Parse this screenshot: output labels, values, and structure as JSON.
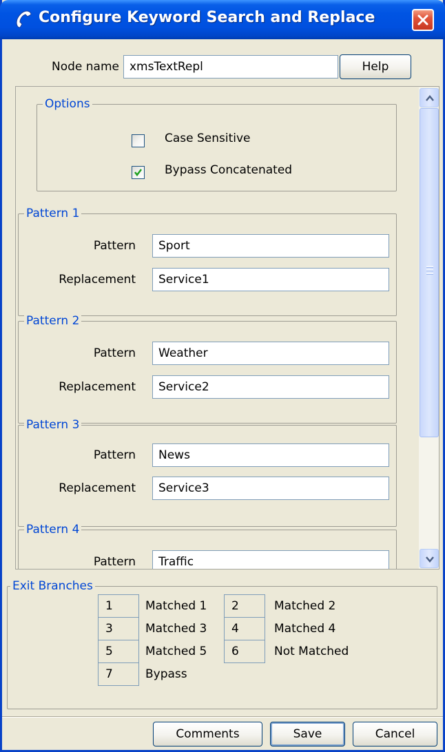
{
  "window": {
    "title": "Configure Keyword Search and Replace"
  },
  "header": {
    "node_name_label": "Node name",
    "node_name_value": "xmsTextRepl",
    "help_label": "Help"
  },
  "options": {
    "legend": "Options",
    "case_sensitive": {
      "label": "Case Sensitive",
      "checked": false
    },
    "bypass_concatenated": {
      "label": "Bypass Concatenated",
      "checked": true
    }
  },
  "patterns": [
    {
      "legend": "Pattern 1",
      "pattern_label": "Pattern",
      "pattern_value": "Sport",
      "replacement_label": "Replacement",
      "replacement_value": "Service1"
    },
    {
      "legend": "Pattern 2",
      "pattern_label": "Pattern",
      "pattern_value": "Weather",
      "replacement_label": "Replacement",
      "replacement_value": "Service2"
    },
    {
      "legend": "Pattern 3",
      "pattern_label": "Pattern",
      "pattern_value": "News",
      "replacement_label": "Replacement",
      "replacement_value": "Service3"
    },
    {
      "legend": "Pattern 4",
      "pattern_label": "Pattern",
      "pattern_value": "Traffic"
    }
  ],
  "exit_branches": {
    "legend": "Exit Branches",
    "items": [
      {
        "number": "1",
        "label": "Matched 1"
      },
      {
        "number": "2",
        "label": "Matched 2"
      },
      {
        "number": "3",
        "label": "Matched 3"
      },
      {
        "number": "4",
        "label": "Matched 4"
      },
      {
        "number": "5",
        "label": "Matched 5"
      },
      {
        "number": "6",
        "label": "Not Matched"
      },
      {
        "number": "7",
        "label": "Bypass"
      }
    ]
  },
  "footer": {
    "comments_label": "Comments",
    "save_label": "Save",
    "cancel_label": "Cancel"
  },
  "colors": {
    "titlebar": "#0054E3",
    "legend_text": "#0046D5",
    "window_bg": "#ECE9D8",
    "check_mark": "#21A121",
    "close_button": "#E0533A"
  },
  "icons": {
    "app": "phone-handset-icon",
    "close": "close-icon",
    "check": "checkmark-icon",
    "scroll_up": "chevron-up-icon",
    "scroll_down": "chevron-down-icon"
  }
}
